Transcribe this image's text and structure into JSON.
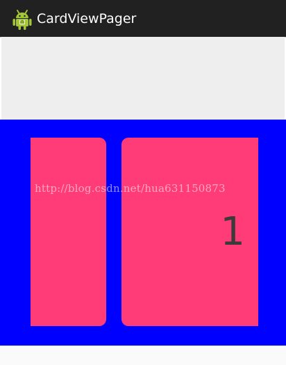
{
  "app": {
    "title": "CardViewPager",
    "icon": "android-robot-icon"
  },
  "pager": {
    "background_color": "#0000ff",
    "card_color": "#ff3b78",
    "current_page_label": "1"
  },
  "watermark": {
    "text": "http://blog.csdn.net/hua631150873"
  },
  "colors": {
    "action_bar": "#212121",
    "top_area": "#eeeeee",
    "page_number_text": "#3b3b3b"
  }
}
